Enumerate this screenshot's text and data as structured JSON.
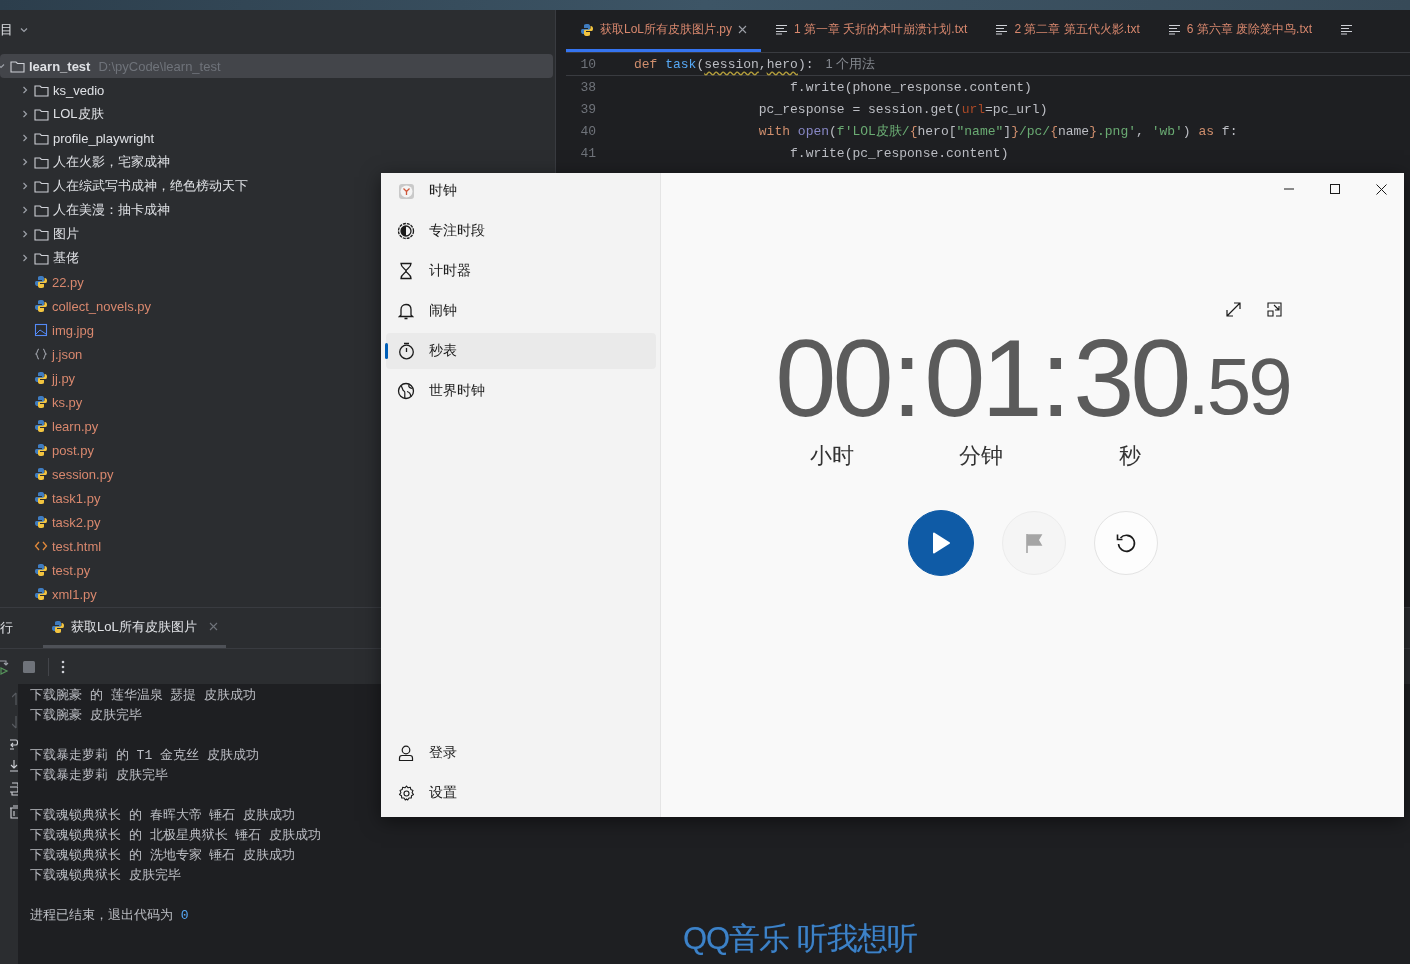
{
  "project_panel": {
    "title": "目",
    "root": {
      "name": "learn_test",
      "path": "D:\\pyCode\\learn_test",
      "expanded": true,
      "selected": true,
      "children": [
        {
          "name": "ks_vedio",
          "kind": "folder",
          "expanded": false
        },
        {
          "name": "LOL皮肤",
          "kind": "folder",
          "expanded": false
        },
        {
          "name": "profile_playwright",
          "kind": "folder",
          "expanded": false
        },
        {
          "name": "人在火影，宅家成神",
          "kind": "folder",
          "expanded": false
        },
        {
          "name": "人在综武写书成神，绝色榜动天下",
          "kind": "folder",
          "expanded": false
        },
        {
          "name": "人在美漫：抽卡成神",
          "kind": "folder",
          "expanded": false
        },
        {
          "name": "图片",
          "kind": "folder",
          "expanded": false
        },
        {
          "name": "基佬",
          "kind": "folder",
          "expanded": false
        },
        {
          "name": "22.py",
          "kind": "python"
        },
        {
          "name": "collect_novels.py",
          "kind": "python"
        },
        {
          "name": "img.jpg",
          "kind": "image"
        },
        {
          "name": "j.json",
          "kind": "json"
        },
        {
          "name": "jj.py",
          "kind": "python"
        },
        {
          "name": "ks.py",
          "kind": "python"
        },
        {
          "name": "learn.py",
          "kind": "python"
        },
        {
          "name": "post.py",
          "kind": "python"
        },
        {
          "name": "session.py",
          "kind": "python"
        },
        {
          "name": "task1.py",
          "kind": "python"
        },
        {
          "name": "task2.py",
          "kind": "python"
        },
        {
          "name": "test.html",
          "kind": "html"
        },
        {
          "name": "test.py",
          "kind": "python"
        },
        {
          "name": "xml1.py",
          "kind": "python"
        }
      ]
    }
  },
  "editor": {
    "tabs": [
      {
        "label": "获取LoL所有皮肤图片.py",
        "kind": "python",
        "selected": true,
        "closable": true
      },
      {
        "label": "1 第一章 夭折的木叶崩溃计划.txt",
        "kind": "text",
        "selected": false,
        "closable": false
      },
      {
        "label": "2 第二章 第五代火影.txt",
        "kind": "text",
        "selected": false,
        "closable": false
      },
      {
        "label": "6 第六章 废除笼中鸟.txt",
        "kind": "text",
        "selected": false,
        "closable": false
      },
      {
        "kind": "text",
        "selected": false,
        "closable": false
      }
    ],
    "sticky_line": {
      "number": "10",
      "tokens": [
        {
          "t": "def ",
          "kind": "kw"
        },
        {
          "t": "task",
          "kind": "fn"
        },
        {
          "t": "(",
          "kind": "plain"
        },
        {
          "t": "session",
          "kind": "warn"
        },
        {
          "t": ",",
          "kind": "plain"
        },
        {
          "t": "hero",
          "kind": "warn"
        },
        {
          "t": "):",
          "kind": "plain"
        }
      ],
      "usages": "1 个用法"
    },
    "lines": [
      {
        "number": "38",
        "tokens": [
          {
            "t": "                    f.write(phone_response.content)",
            "kind": "plain"
          }
        ]
      },
      {
        "number": "39",
        "tokens": [
          {
            "t": "                pc_response = session.get(",
            "kind": "plain"
          },
          {
            "t": "url",
            "kind": "arg"
          },
          {
            "t": "=pc_url)",
            "kind": "plain"
          }
        ]
      },
      {
        "number": "40",
        "tokens": [
          {
            "t": "                with ",
            "kind": "kw"
          },
          {
            "t": "open",
            "kind": "builtin"
          },
          {
            "t": "(",
            "kind": "plain"
          },
          {
            "t": "f'LOL皮肤/",
            "kind": "str"
          },
          {
            "t": "{",
            "kind": "kw"
          },
          {
            "t": "hero[",
            "kind": "plain"
          },
          {
            "t": "\"name\"",
            "kind": "str"
          },
          {
            "t": "]",
            "kind": "plain"
          },
          {
            "t": "}",
            "kind": "kw"
          },
          {
            "t": "/pc/",
            "kind": "str"
          },
          {
            "t": "{",
            "kind": "kw"
          },
          {
            "t": "name",
            "kind": "plain"
          },
          {
            "t": "}",
            "kind": "kw"
          },
          {
            "t": ".png'",
            "kind": "str"
          },
          {
            "t": ", ",
            "kind": "plain"
          },
          {
            "t": "'wb'",
            "kind": "str"
          },
          {
            "t": ") ",
            "kind": "plain"
          },
          {
            "t": "as ",
            "kind": "kw"
          },
          {
            "t": "f:",
            "kind": "plain"
          }
        ]
      },
      {
        "number": "41",
        "tokens": [
          {
            "t": "                    f.write(pc_response.content)",
            "kind": "plain"
          }
        ]
      }
    ]
  },
  "run_panel": {
    "title": "行",
    "tab": {
      "label": "获取LoL所有皮肤图片",
      "selected": true
    },
    "output": [
      [
        "下载腕豪 的 莲华温泉 瑟提 皮肤成功",
        "下载腕豪 皮肤完毕"
      ],
      [
        "下载暴走萝莉 的 T1 金克丝 皮肤成功",
        "下载暴走萝莉 皮肤完毕"
      ],
      [
        "下载魂锁典狱长 的 春晖大帝 锤石 皮肤成功",
        "下载魂锁典狱长 的 北极星典狱长 锤石 皮肤成功",
        "下载魂锁典狱长 的 洗地专家 锤石 皮肤成功",
        "下载魂锁典狱长 皮肤完毕"
      ]
    ],
    "exit": {
      "message": "进程已结束，退出代码为 ",
      "code": "0"
    }
  },
  "clock_app": {
    "nav": [
      {
        "label": "时钟",
        "selected": false
      },
      {
        "label": "专注时段",
        "selected": false
      },
      {
        "label": "计时器",
        "selected": false
      },
      {
        "label": "闹钟",
        "selected": false
      },
      {
        "label": "秒表",
        "selected": true
      },
      {
        "label": "世界时钟",
        "selected": false
      }
    ],
    "footer": [
      {
        "label": "登录"
      },
      {
        "label": "设置"
      }
    ],
    "stopwatch": {
      "units": [
        {
          "value": "00",
          "label": "小时",
          "separator": ":"
        },
        {
          "value": "01",
          "label": "分钟",
          "separator": ":"
        },
        {
          "value": "30",
          "label": "秒"
        }
      ],
      "fraction": ".59",
      "controls": [
        {
          "kind": "play",
          "disabled": false
        },
        {
          "kind": "lap",
          "disabled": true
        },
        {
          "kind": "reset",
          "disabled": false
        }
      ]
    }
  },
  "lyrics": {
    "text": "QQ音乐 听我想听"
  }
}
